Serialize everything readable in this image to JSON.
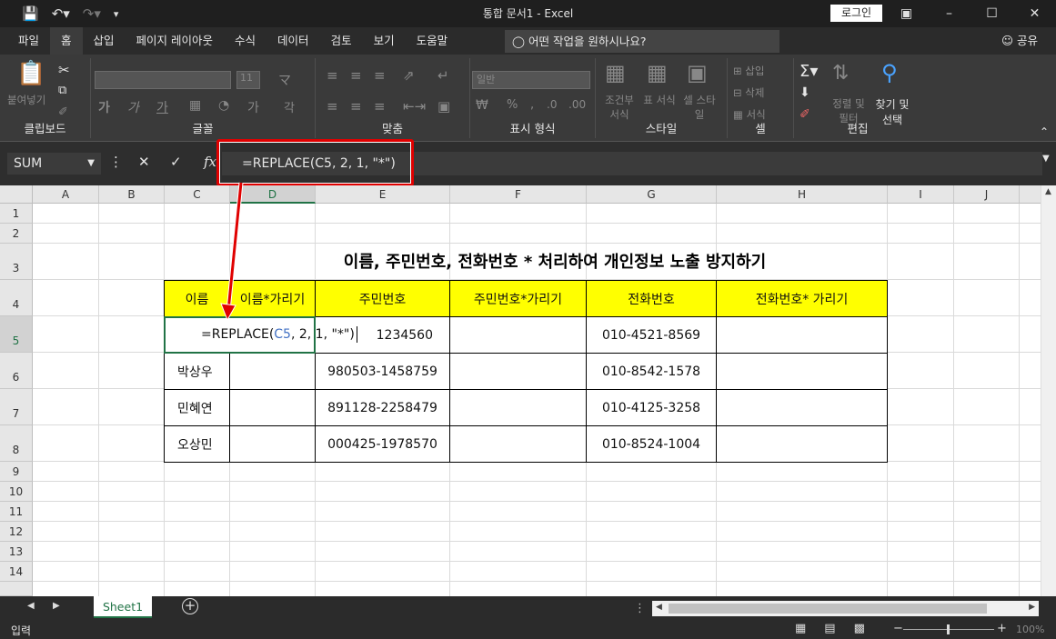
{
  "titlebar": {
    "qat": {
      "save_icon": "save-icon",
      "undo_icon": "undo-icon",
      "redo_icon": "redo-icon",
      "customize_icon": "customize-icon"
    },
    "title": "통합 문서1  -  Excel",
    "login": "로그인",
    "window_buttons": [
      "ribbon-display-icon",
      "minimize-icon",
      "maximize-icon",
      "close-icon"
    ]
  },
  "tabs": {
    "items": [
      "파일",
      "홈",
      "삽입",
      "페이지 레이아웃",
      "수식",
      "데이터",
      "검토",
      "보기",
      "도움말"
    ],
    "active": "홈",
    "tell_me": "어떤 작업을 원하시나요?",
    "share": "공유"
  },
  "ribbon": {
    "clipboard": {
      "label": "클립보드",
      "paste": "붙여넣기"
    },
    "font": {
      "label": "글꼴",
      "size": "11",
      "bold": "가",
      "underline": "가",
      "char": "가"
    },
    "align": {
      "label": "맞춤"
    },
    "number": {
      "label": "표시 형식",
      "format": "일반"
    },
    "styles": {
      "label": "스타일",
      "cond_format": "조건부 서식",
      "table": "표 서식",
      "cell_style": "셀 스타일"
    },
    "cells": {
      "label": "셀",
      "insert": "삽입",
      "delete": "삭제",
      "format": "서식"
    },
    "editing": {
      "label": "편집",
      "sort_filter": "정렬 및 필터",
      "find_select": "찾기 및 선택"
    }
  },
  "formula_bar": {
    "name_box": "SUM",
    "formula": "=REPLACE(C5, 2, 1, \"*\")"
  },
  "columns": [
    "A",
    "B",
    "C",
    "D",
    "E",
    "F",
    "G",
    "H",
    "I",
    "J"
  ],
  "rows": [
    "1",
    "2",
    "3",
    "4",
    "5",
    "6",
    "7",
    "8",
    "9",
    "10",
    "11",
    "12",
    "13",
    "14"
  ],
  "sheet": {
    "title": "이름, 주민번호, 전화번호 * 처리하여 개인정보 노출 방지하기",
    "headers": [
      "이름",
      "이름*가리기",
      "주민번호",
      "주민번호*가리기",
      "전화번호",
      "전화번호* 가리기"
    ],
    "rows": [
      {
        "name": "",
        "masked_name": "",
        "rrn": "1234560",
        "masked_rrn": "",
        "phone": "010-4521-8569",
        "masked_phone": ""
      },
      {
        "name": "박상우",
        "masked_name": "",
        "rrn": "980503-1458759",
        "masked_rrn": "",
        "phone": "010-8542-1578",
        "masked_phone": ""
      },
      {
        "name": "민혜연",
        "masked_name": "",
        "rrn": "891128-2258479",
        "masked_rrn": "",
        "phone": "010-4125-3258",
        "masked_phone": ""
      },
      {
        "name": "오상민",
        "masked_name": "",
        "rrn": "000425-1978570",
        "masked_rrn": "",
        "phone": "010-8524-1004",
        "masked_phone": ""
      }
    ],
    "editing_cell": {
      "prefix": "=REPLACE(",
      "ref": "C5",
      "suffix": ", 2, 1, \"*\")"
    }
  },
  "sheet_tabs": {
    "active": "Sheet1"
  },
  "status": {
    "mode": "입력",
    "zoom": "100%"
  }
}
